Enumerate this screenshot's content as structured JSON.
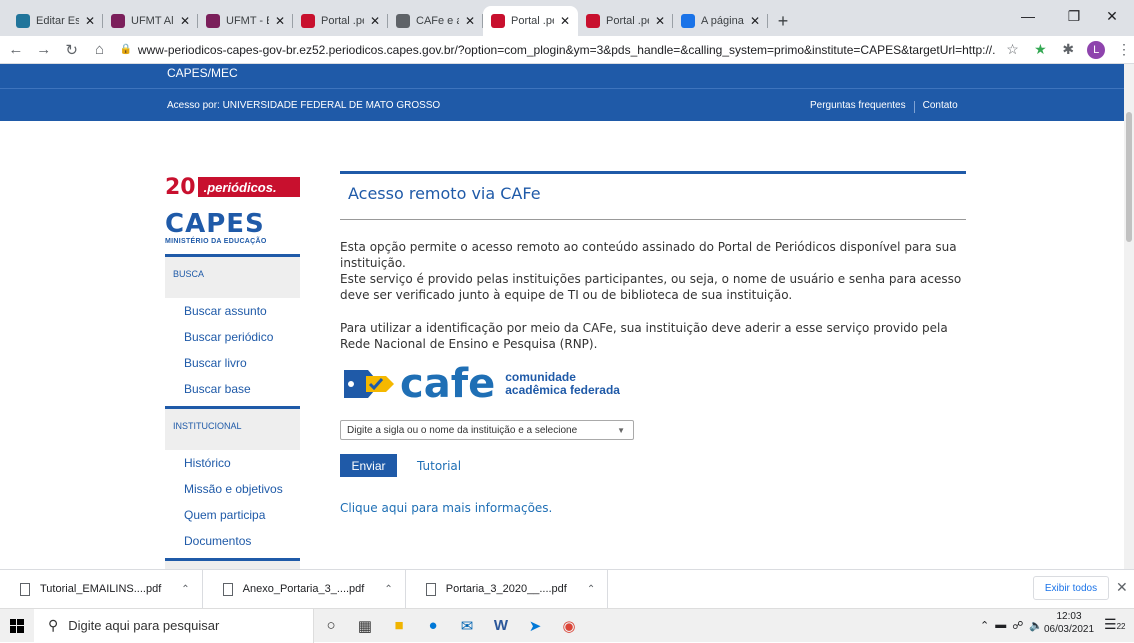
{
  "browser": {
    "tabs": [
      {
        "label": "Editar Estrutur",
        "icon": "wordpress-icon",
        "color": "#21759b",
        "active": false
      },
      {
        "label": "UFMT Aluno -",
        "icon": "ufmt-icon",
        "color": "#7b1f5b",
        "active": false
      },
      {
        "label": "UFMT - BIBLIO",
        "icon": "ufmt-icon",
        "color": "#7b1f5b",
        "active": false
      },
      {
        "label": "Portal .periódi",
        "icon": "portal-icon",
        "color": "#c8102e",
        "active": false
      },
      {
        "label": "CAFe e acesso",
        "icon": "chrome-icon",
        "color": "#5f6368",
        "active": false
      },
      {
        "label": "Portal .periódi",
        "icon": "portal-icon",
        "color": "#c8102e",
        "active": true
      },
      {
        "label": "Portal .periódi",
        "icon": "portal-icon",
        "color": "#c8102e",
        "active": false
      },
      {
        "label": "A página não f",
        "icon": "page-icon",
        "color": "#1a73e8",
        "active": false
      }
    ],
    "url": "www-periodicos-capes-gov-br.ez52.periodicos.capes.gov.br/?option=com_plogin&ym=3&pds_handle=&calling_system=primo&institute=CAPES&targetUrl=http://...",
    "profile_initial": "L"
  },
  "site": {
    "brand": "CAPES/MEC",
    "access_by": "Acesso por: UNIVERSIDADE FEDERAL DE MATO GROSSO",
    "faq": "Perguntas frequentes",
    "contact": "Contato"
  },
  "sidebar": {
    "logo_num": "20",
    "logo_text": ".periódicos.",
    "capes": "CAPES",
    "ministry": "MINISTÉRIO DA EDUCAÇÃO",
    "busca_head": "BUSCA",
    "busca_items": [
      "Buscar assunto",
      "Buscar periódico",
      "Buscar livro",
      "Buscar base"
    ],
    "inst_head": "INSTITUCIONAL",
    "inst_items": [
      "Histórico",
      "Missão e objetivos",
      "Quem participa",
      "Documentos"
    ]
  },
  "main": {
    "title": "Acesso remoto via CAFe",
    "p1": "Esta opção permite o acesso remoto ao conteúdo assinado do Portal de Periódicos disponível para sua instituição.",
    "p2": "Este serviço é provido pelas instituições participantes, ou seja, o nome de usuário e senha para acesso deve ser verificado junto à equipe de TI ou de biblioteca de sua instituição.",
    "p3": "Para utilizar a identificação por meio da CAFe, sua instituição deve aderir a esse serviço provido pela Rede Nacional de Ensino e Pesquisa (RNP).",
    "cafe_word": "cafe",
    "cafe_sub1": "comunidade",
    "cafe_sub2": "acadêmica federada",
    "select_placeholder": "Digite a sigla ou o nome da instituição e a selecione",
    "send": "Enviar",
    "tutorial": "Tutorial",
    "more_info": "Clique aqui para mais informações."
  },
  "downloads": {
    "items": [
      "Tutorial_EMAILINS....pdf",
      "Anexo_Portaria_3_....pdf",
      "Portaria_3_2020__....pdf"
    ],
    "show_all": "Exibir todos"
  },
  "taskbar": {
    "search_placeholder": "Digite aqui para pesquisar",
    "time": "12:03",
    "date": "06/03/2021",
    "notifications": "22"
  }
}
